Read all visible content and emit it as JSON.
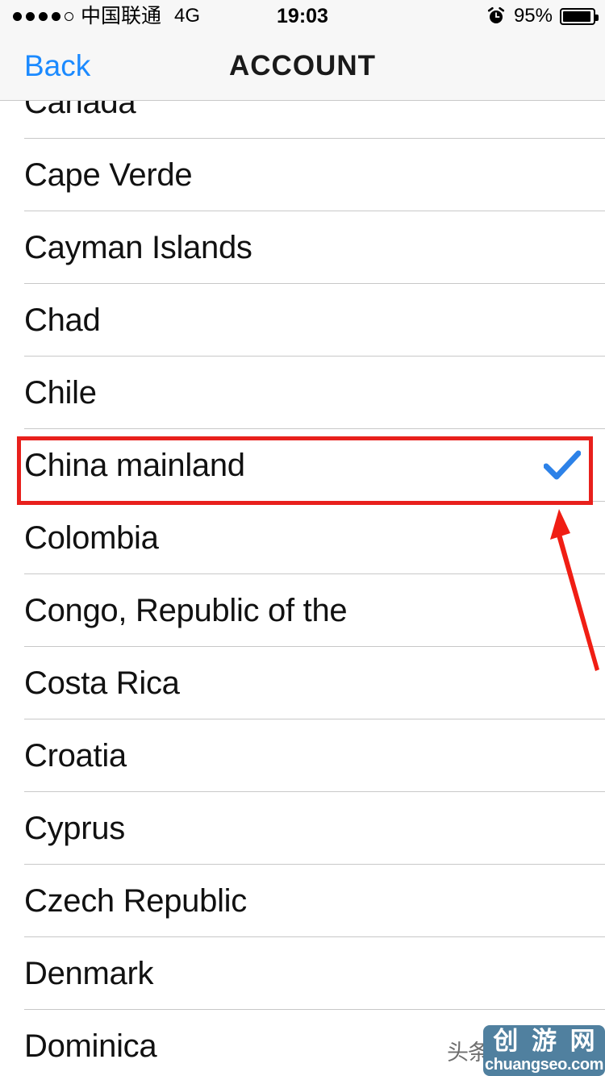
{
  "status_bar": {
    "signal_dots_total": 5,
    "signal_dots_filled": 4,
    "carrier": "中国联通",
    "network": "4G",
    "time": "19:03",
    "alarm_icon": "alarm-clock-icon",
    "battery_percent": "95%",
    "battery_level": 95
  },
  "nav_bar": {
    "back_label": "Back",
    "title": "ACCOUNT",
    "back_color": "#1b8aff"
  },
  "list": {
    "rows": [
      {
        "label": "Canada",
        "selected": false,
        "clipped": true
      },
      {
        "label": "Cape Verde",
        "selected": false,
        "clipped": false
      },
      {
        "label": "Cayman Islands",
        "selected": false,
        "clipped": false
      },
      {
        "label": "Chad",
        "selected": false,
        "clipped": false
      },
      {
        "label": "Chile",
        "selected": false,
        "clipped": false
      },
      {
        "label": "China mainland",
        "selected": true,
        "clipped": false
      },
      {
        "label": "Colombia",
        "selected": false,
        "clipped": false
      },
      {
        "label": "Congo, Republic of the",
        "selected": false,
        "clipped": false
      },
      {
        "label": "Costa Rica",
        "selected": false,
        "clipped": false
      },
      {
        "label": "Croatia",
        "selected": false,
        "clipped": false
      },
      {
        "label": "Cyprus",
        "selected": false,
        "clipped": false
      },
      {
        "label": "Czech Republic",
        "selected": false,
        "clipped": false
      },
      {
        "label": "Denmark",
        "selected": false,
        "clipped": false
      },
      {
        "label": "Dominica",
        "selected": false,
        "clipped": false
      }
    ],
    "checkmark_color": "#2d82e8"
  },
  "annotations": {
    "highlight_box_target": "China mainland",
    "highlight_color": "#e8201c",
    "arrow_color": "#f01e14",
    "arrow_points_to": "China mainland"
  },
  "watermark": {
    "source_label": "头条",
    "logo_cn": "创游网",
    "logo_url": "chuangseo.com",
    "logo_bg": "#50809f"
  }
}
